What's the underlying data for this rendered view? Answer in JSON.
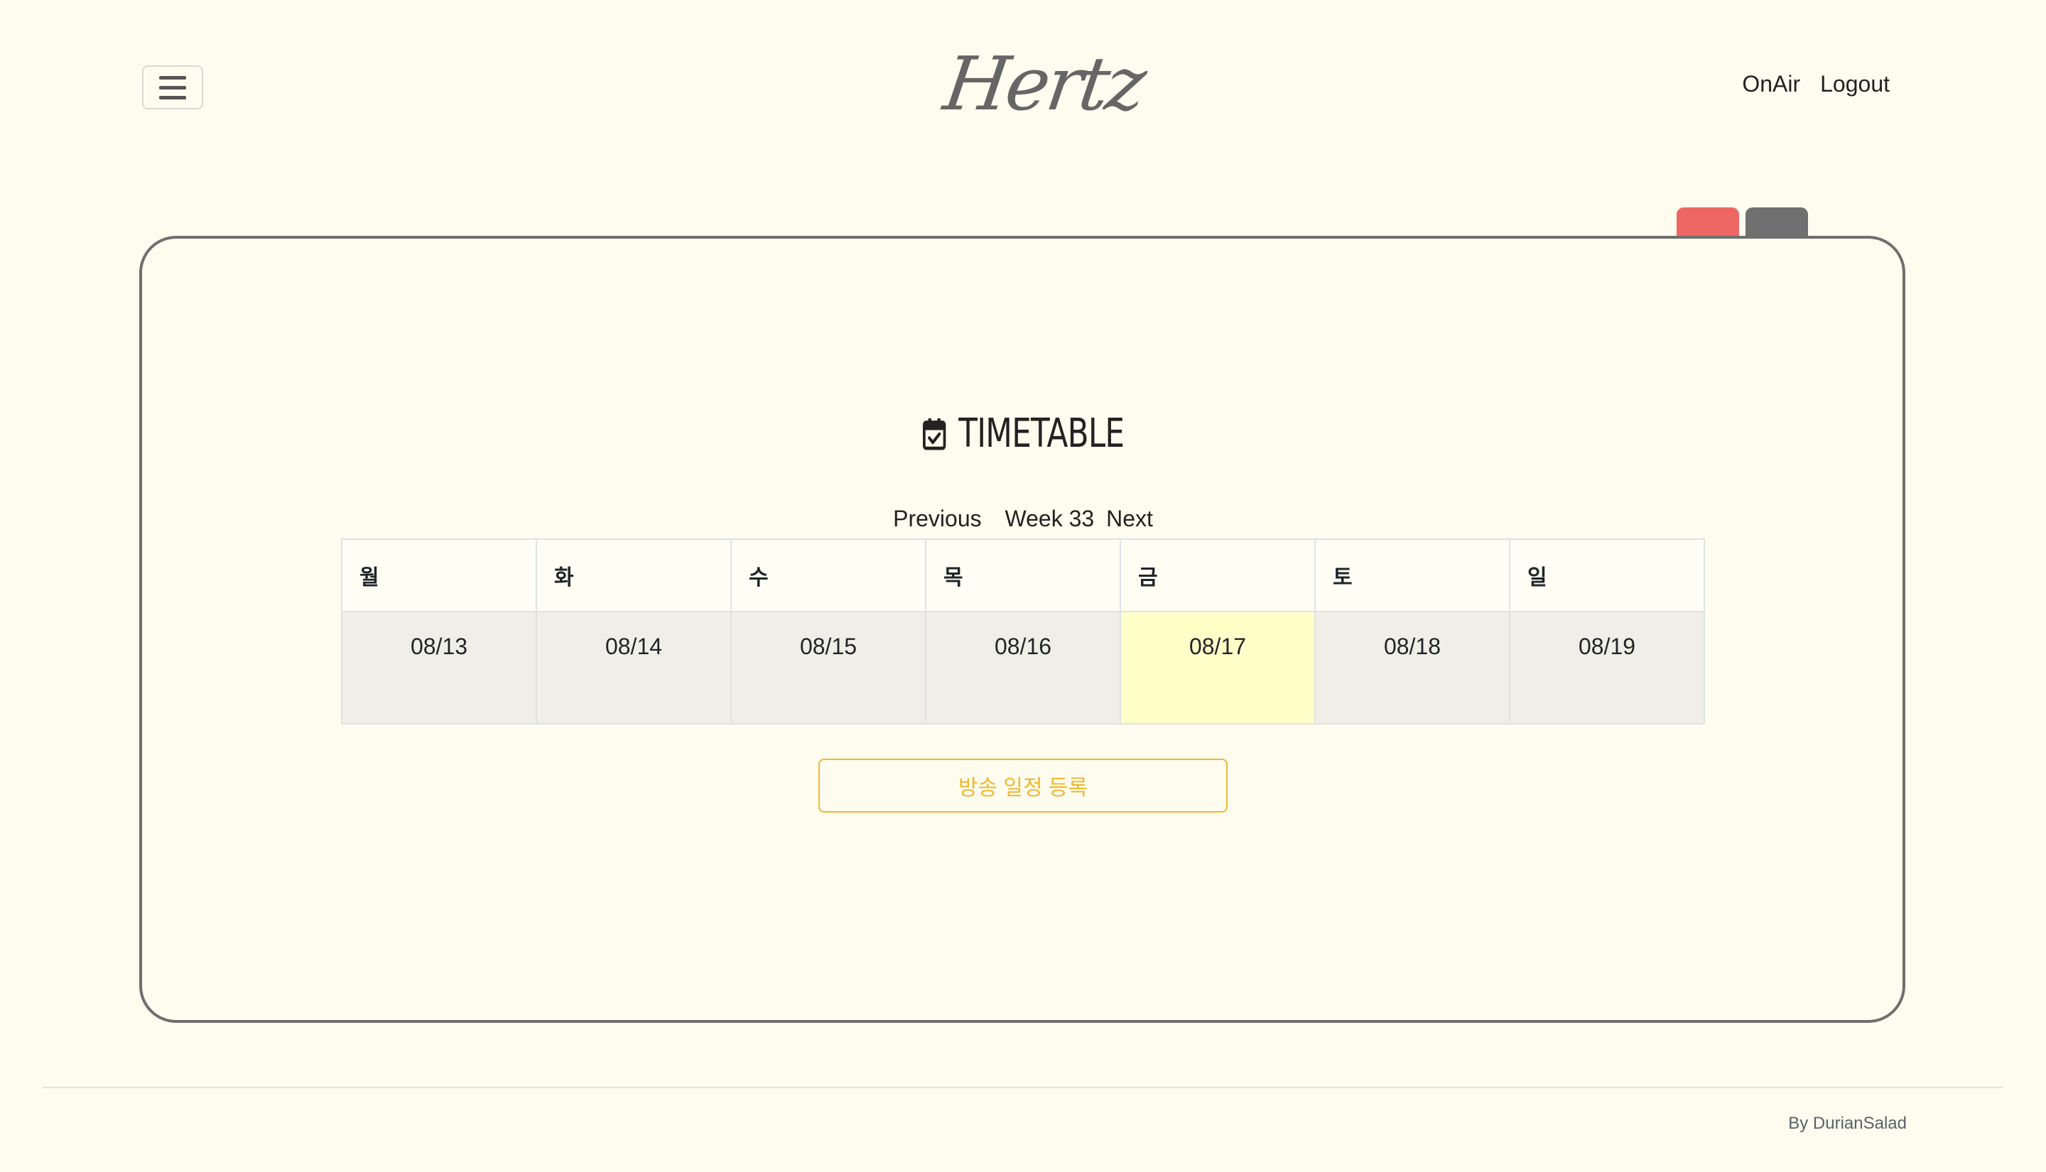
{
  "header": {
    "logo_text": "Hertz",
    "menu_icon": "hamburger-icon",
    "nav": [
      "OnAir",
      "Logout"
    ]
  },
  "tabs": {
    "colors": [
      "#ee6663",
      "#707070"
    ]
  },
  "timetable": {
    "title_icon": "calendar-check-icon",
    "title": "TIMETABLE",
    "previous_label": "Previous",
    "week_label": "Week 33",
    "next_label": "Next",
    "days": [
      "월",
      "화",
      "수",
      "목",
      "금",
      "토",
      "일"
    ],
    "dates": [
      "08/13",
      "08/14",
      "08/15",
      "08/16",
      "08/17",
      "08/18",
      "08/19"
    ],
    "highlighted_date": "08/17",
    "highlight_color": "#ffffc8",
    "register_label": "방송 일정 등록",
    "register_color": "#f0b832"
  },
  "footer": {
    "text": "By DurianSalad"
  }
}
